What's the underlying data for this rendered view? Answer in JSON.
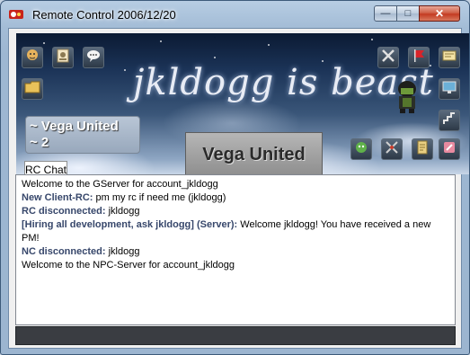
{
  "window": {
    "title": "Remote Control 2006/12/20",
    "app_icon": "app-logo-icon",
    "controls": {
      "minimize": "minimize-icon",
      "maximize": "maximize-icon",
      "close": "close-icon"
    }
  },
  "banner": {
    "title": "jkldogg is beast",
    "left_toolbar": [
      "player-list-icon",
      "profile-icon",
      "chat-bubble-icon",
      "folder-icon"
    ],
    "right_toolbar_top": [
      "tools-icon",
      "flag-icon",
      "server-options-icon"
    ],
    "right_toolbar_mid": [
      "screen-monitor-icon",
      "stair-icon"
    ],
    "right_toolbar_bottom": [
      "creature-icon",
      "swords-icon",
      "document-icon",
      "warning-icon"
    ],
    "avatar_icon": "character-avatar-icon"
  },
  "server": {
    "name_lines": [
      "~ Vega United",
      "~ 2"
    ],
    "logo_text": "Vega United"
  },
  "tabs": [
    {
      "label": "RC Chat",
      "active": true
    }
  ],
  "chat": {
    "lines": [
      {
        "nick": "",
        "text": "Welcome to the GServer for account_jkldogg"
      },
      {
        "nick": "New Client-RC:",
        "text": " pm my rc if need me (jkldogg)"
      },
      {
        "nick": "RC disconnected:",
        "text": " jkldogg"
      },
      {
        "nick": "[Hiring all development, ask jkldogg] (Server):",
        "text": " Welcome jkldogg! You have received a new PM!"
      },
      {
        "nick": "NC disconnected:",
        "text": " jkldogg"
      },
      {
        "nick": "",
        "text": "Welcome to the NPC-Server for account_jkldogg"
      }
    ]
  },
  "input": {
    "value": ""
  },
  "colors": {
    "nick": "#37476b",
    "input_bg": "#3a3d42"
  }
}
